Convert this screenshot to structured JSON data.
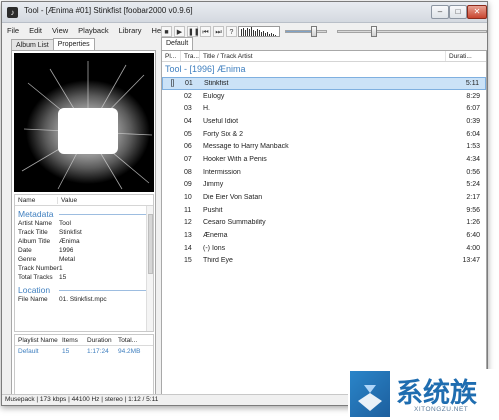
{
  "window": {
    "title": "Tool - [Ænima #01] Stinkfist   [foobar2000 v0.9.6]",
    "controls": {
      "minimize": "–",
      "maximize": "□",
      "close": "✕"
    }
  },
  "menu": [
    "File",
    "Edit",
    "View",
    "Playback",
    "Library",
    "Help"
  ],
  "toolbar": {
    "stop_icon": "stop-icon",
    "play_icon": "play-icon",
    "pause_icon": "pause-icon",
    "prev_icon": "previous-icon",
    "next_icon": "next-icon",
    "random_icon": "random-icon",
    "volume": 0.67,
    "seek_position": 0.24
  },
  "left_tabs": [
    "Album List",
    "Properties"
  ],
  "properties": {
    "columns": {
      "name": "Name",
      "value": "Value"
    },
    "metadata_title": "Metadata",
    "metadata": [
      {
        "key": "Artist Name",
        "value": "Tool"
      },
      {
        "key": "Track Title",
        "value": "Stinkfist"
      },
      {
        "key": "Album Title",
        "value": "Ænima"
      },
      {
        "key": "Date",
        "value": "1996"
      },
      {
        "key": "Genre",
        "value": "Metal"
      },
      {
        "key": "Track Number",
        "value": "1"
      },
      {
        "key": "Total Tracks",
        "value": "15"
      }
    ],
    "location_title": "Location",
    "location": [
      {
        "key": "File Name",
        "value": "01. Stinkfist.mpc"
      }
    ]
  },
  "playlist_manager": {
    "columns": {
      "name": "Playlist Name",
      "items": "Items",
      "duration": "Duration",
      "total": "Total..."
    },
    "rows": [
      {
        "name": "Default",
        "items": "15",
        "duration": "1:17:24",
        "total": "94.2MB"
      }
    ]
  },
  "playlist_tab": "Default",
  "playlist": {
    "columns": {
      "playing": "Pl...",
      "track": "Tra...",
      "title": "Title / Track Artist",
      "duration": "Durati..."
    },
    "group": "Tool - [1996] Ænima",
    "tracks": [
      {
        "num": "01",
        "title": "Stinkfist",
        "duration": "5:11",
        "playing": true
      },
      {
        "num": "02",
        "title": "Eulogy",
        "duration": "8:29"
      },
      {
        "num": "03",
        "title": "H.",
        "duration": "6:07"
      },
      {
        "num": "04",
        "title": "Useful Idiot",
        "duration": "0:39"
      },
      {
        "num": "05",
        "title": "Forty Six & 2",
        "duration": "6:04"
      },
      {
        "num": "06",
        "title": "Message to Harry Manback",
        "duration": "1:53"
      },
      {
        "num": "07",
        "title": "Hooker With a Penis",
        "duration": "4:34"
      },
      {
        "num": "08",
        "title": "Intermission",
        "duration": "0:56"
      },
      {
        "num": "09",
        "title": "Jimmy",
        "duration": "5:24"
      },
      {
        "num": "10",
        "title": "Die Eier Von Satan",
        "duration": "2:17"
      },
      {
        "num": "11",
        "title": "Pushit",
        "duration": "9:56"
      },
      {
        "num": "12",
        "title": "Cesaro Summability",
        "duration": "1:26"
      },
      {
        "num": "13",
        "title": "Ænema",
        "duration": "6:40"
      },
      {
        "num": "14",
        "title": "(-) Ions",
        "duration": "4:00"
      },
      {
        "num": "15",
        "title": "Third Eye",
        "duration": "13:47"
      }
    ],
    "playing_marker": "[]"
  },
  "status": "Musepack | 173 kbps | 44100 Hz | stereo | 1:12 / 5:11",
  "watermark": {
    "main": "系统族",
    "sub": "XITONGZU.NET"
  },
  "colors": {
    "accent": "#3f7fbf",
    "selection": "#cbe2f7"
  }
}
